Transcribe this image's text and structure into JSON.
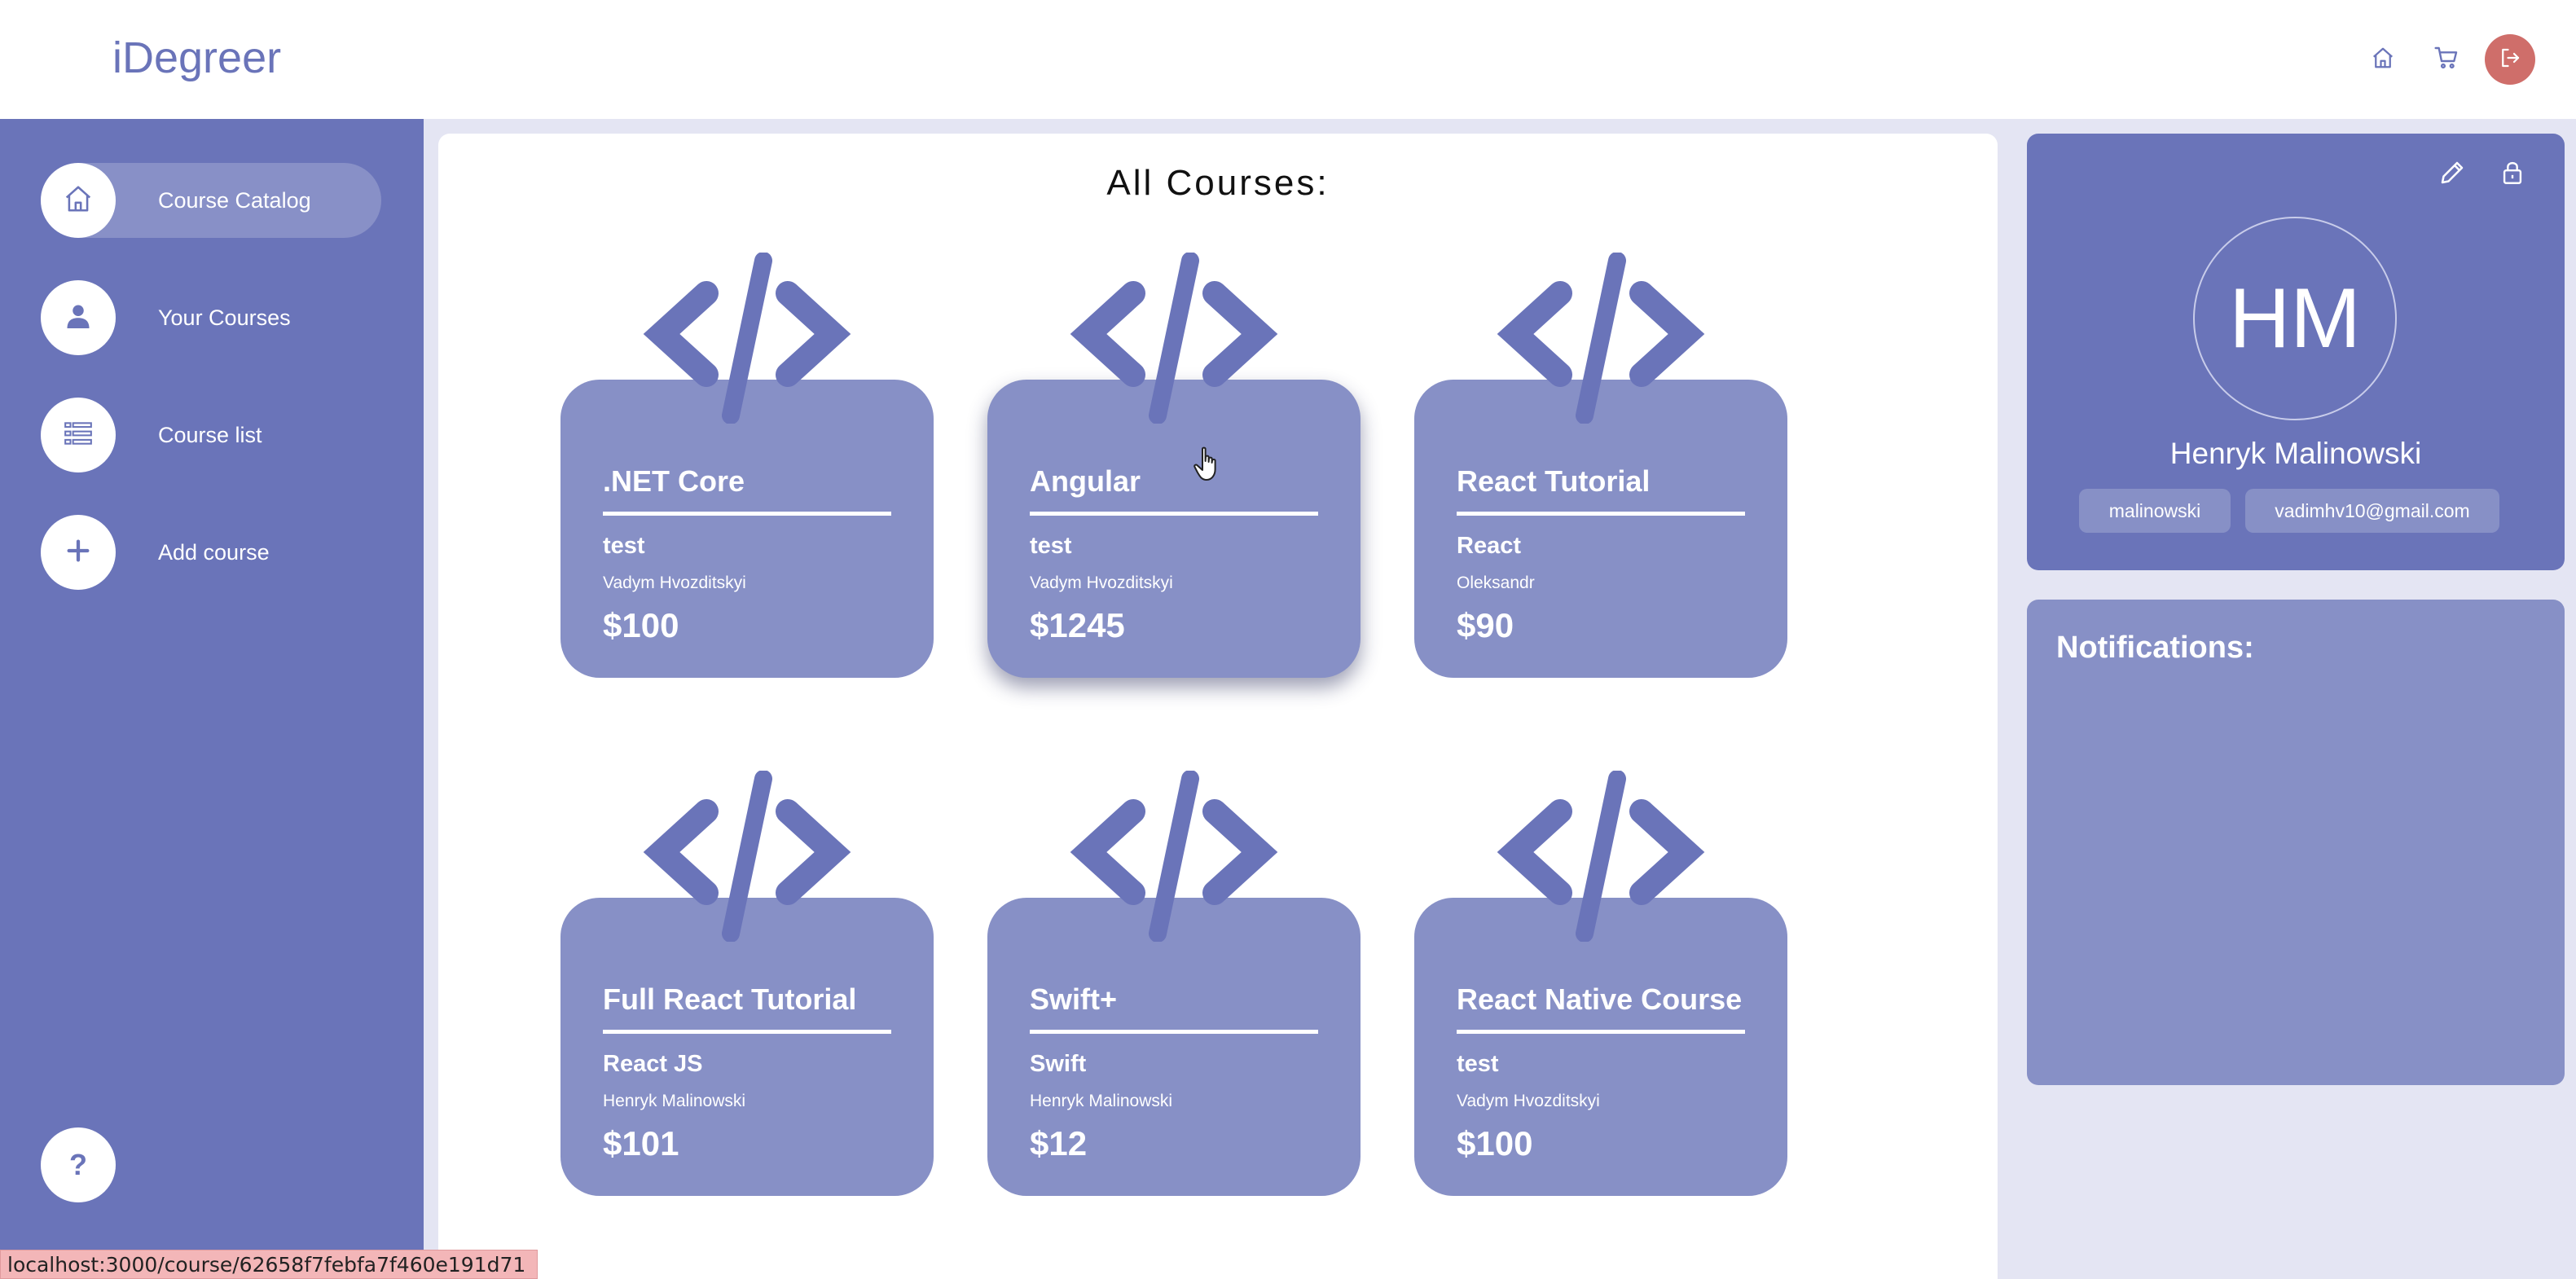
{
  "app": {
    "logo": "iDegreer"
  },
  "header": {
    "icons": [
      "home-icon",
      "cart-icon",
      "logout-icon"
    ],
    "logout_color": "#cf6e6a"
  },
  "sidebar": {
    "items": [
      {
        "label": "Course Catalog",
        "icon": "home-icon",
        "active": true
      },
      {
        "label": "Your Courses",
        "icon": "user-icon",
        "active": false
      },
      {
        "label": "Course list",
        "icon": "list-icon",
        "active": false
      },
      {
        "label": "Add course",
        "icon": "plus-icon",
        "active": false
      }
    ],
    "help_label": "?"
  },
  "main": {
    "title": "All Courses:",
    "courses": [
      {
        "title": ".NET Core",
        "category": "test",
        "author": "Vadym Hvozditskyi",
        "price": "$100"
      },
      {
        "title": "Angular",
        "category": "test",
        "author": "Vadym Hvozditskyi",
        "price": "$1245"
      },
      {
        "title": "React Tutorial",
        "category": "React",
        "author": "Oleksandr",
        "price": "$90"
      },
      {
        "title": "Full React Tutorial",
        "category": "React JS",
        "author": "Henryk Malinowski",
        "price": "$101"
      },
      {
        "title": "Swift+",
        "category": "Swift",
        "author": "Henryk Malinowski",
        "price": "$12"
      },
      {
        "title": "React Native Course",
        "category": "test",
        "author": "Vadym Hvozditskyi",
        "price": "$100"
      }
    ]
  },
  "profile": {
    "initials": "HM",
    "name": "Henryk Malinowski",
    "username": "malinowski",
    "email": "vadimhv10@gmail.com",
    "icons": [
      "pencil-icon",
      "lock-icon"
    ]
  },
  "notifications": {
    "title": "Notifications:"
  },
  "status_bar": {
    "url": "localhost:3000/course/62658f7febfa7f460e191d71"
  },
  "colors": {
    "primary": "#6a74b9",
    "card": "#8790c6",
    "background": "#e4e5f3"
  }
}
